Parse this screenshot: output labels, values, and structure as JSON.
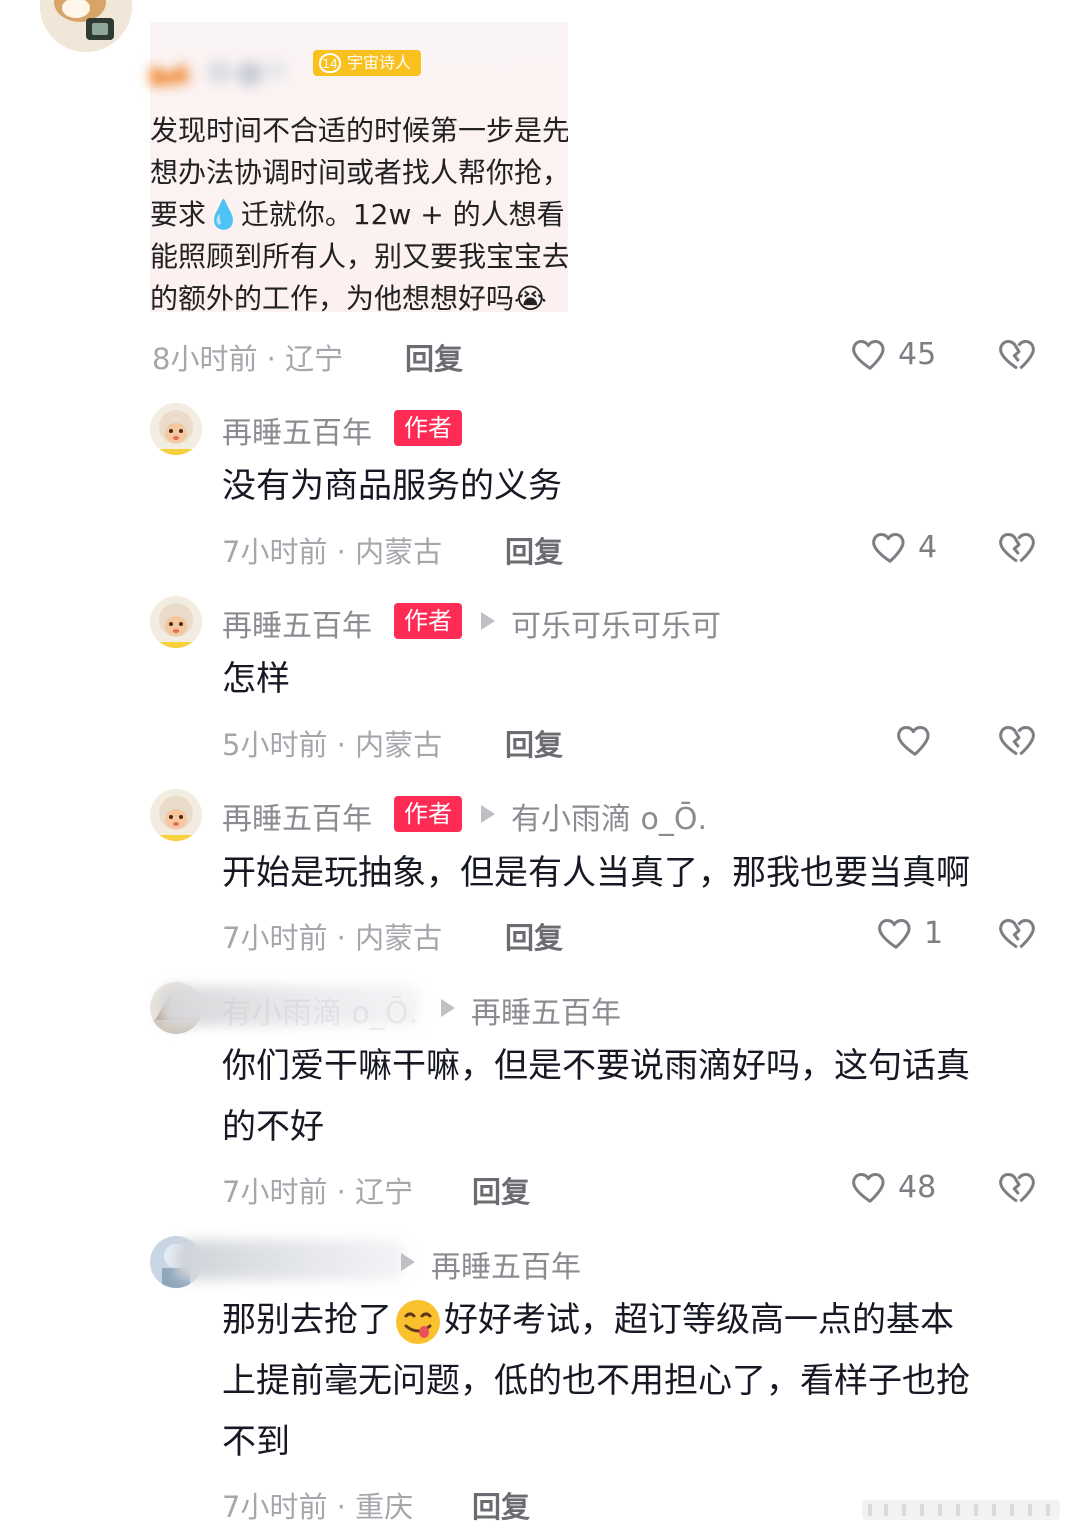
{
  "top_comment": {
    "quoted_user_name": "",
    "level_badge_num": "14",
    "level_badge_text": "宇宙诗人",
    "quote_lines": [
      "发现时间不合适的时候第一步是先",
      "想办法协调时间或者找人帮你抢，",
      "要求💧迁就你。12w + 的人想看，",
      "能照顾到所有人，别又要我宝宝去",
      "的额外的工作，为他想想好吗😭"
    ],
    "meta": "8小时前 · 辽宁",
    "reply_label": "回复",
    "like_count": "45"
  },
  "replies": [
    {
      "user": "再睡五百年",
      "author_tag": "作者",
      "target": "",
      "text_lines": [
        "没有为商品服务的义务"
      ],
      "meta": "7小时前 · 内蒙古",
      "reply_label": "回复",
      "like_count": "4"
    },
    {
      "user": "再睡五百年",
      "author_tag": "作者",
      "target": "可乐可乐可乐可",
      "text_lines": [
        "怎样"
      ],
      "meta": "5小时前 · 内蒙古",
      "reply_label": "回复",
      "like_count": ""
    },
    {
      "user": "再睡五百年",
      "author_tag": "作者",
      "target": "有小雨滴 o_Ō.",
      "text_lines": [
        "开始是玩抽象，但是有人当真了，那我也要当真啊"
      ],
      "meta": "7小时前 · 内蒙古",
      "reply_label": "回复",
      "like_count": "1"
    },
    {
      "user": "有小雨滴 o_Ō.",
      "author_tag": "",
      "target": "再睡五百年",
      "text_lines": [
        "你们爱干嘛干嘛，但是不要说雨滴好吗，这句话真",
        "的不好"
      ],
      "meta": "7小时前 · 辽宁",
      "reply_label": "回复",
      "like_count": "48"
    },
    {
      "user": "",
      "author_tag": "",
      "target": "再睡五百年",
      "text_pre_emoji": "那别去抢了",
      "text_post_emoji": "好好考试，超订等级高一点的基本",
      "text_lines_rest": [
        "上提前毫无问题，低的也不用担心了，看样子也抢",
        "不到"
      ],
      "meta": "7小时前 · 重庆",
      "reply_label": "回复"
    }
  ],
  "icons": {
    "like": "heart-outline-icon",
    "dislike": "broken-heart-icon",
    "reply_arrow": "triangle-right-icon"
  },
  "colors": {
    "author_tag": "#fe2c55",
    "level_badge": "#f9c11f",
    "meta_gray": "#a6a7ac",
    "name_gray": "#8b8c92"
  }
}
